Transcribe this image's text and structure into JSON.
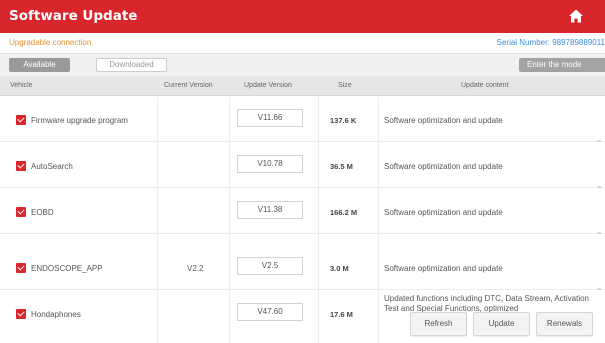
{
  "header": {
    "title": "Software Update",
    "home_icon": "home-icon",
    "bar_color": "#d9262d"
  },
  "info": {
    "connection_status": "Upgradable connection",
    "serial_label": "Serial Number: 989789889011"
  },
  "tabs": [
    {
      "label": "Available",
      "active": true
    },
    {
      "label": "Downloaded",
      "active": false
    }
  ],
  "search": {
    "value": "Enter the mode"
  },
  "table": {
    "columns": {
      "vehicle": "Vehicle",
      "current": "Current Version",
      "update": "Update Version",
      "size": "Size",
      "content": "Update content"
    },
    "rows": [
      {
        "checked": true,
        "vehicle": "Firmware upgrade program",
        "current": "",
        "update": "V11.66",
        "size": "137.6 K",
        "content": "Software optimization and update"
      },
      {
        "checked": true,
        "vehicle": "AutoSearch",
        "current": "",
        "update": "V10.78",
        "size": "36.5 M",
        "content": "Software optimization and update"
      },
      {
        "checked": true,
        "vehicle": "EOBD",
        "current": "",
        "update": "V11.38",
        "size": "166.2 M",
        "content": "Software optimization and update"
      },
      {
        "checked": true,
        "vehicle": "ENDOSCOPE_APP",
        "current": "V2.2",
        "update": "V2.5",
        "size": "3.0 M",
        "content": "Software optimization and update"
      },
      {
        "checked": true,
        "vehicle": "Hondaphones",
        "current": "",
        "update": "V47.60",
        "size": "17.6 M",
        "content": "Updated functions including DTC, Data Stream, Activation Test and Special Functions, optimized"
      }
    ]
  },
  "buttons": {
    "refresh": "Refresh",
    "update": "Update",
    "renewals": "Renewals"
  },
  "colors": {
    "accent": "#d9262d",
    "status": "#e8912f",
    "link": "#3a8ede"
  }
}
